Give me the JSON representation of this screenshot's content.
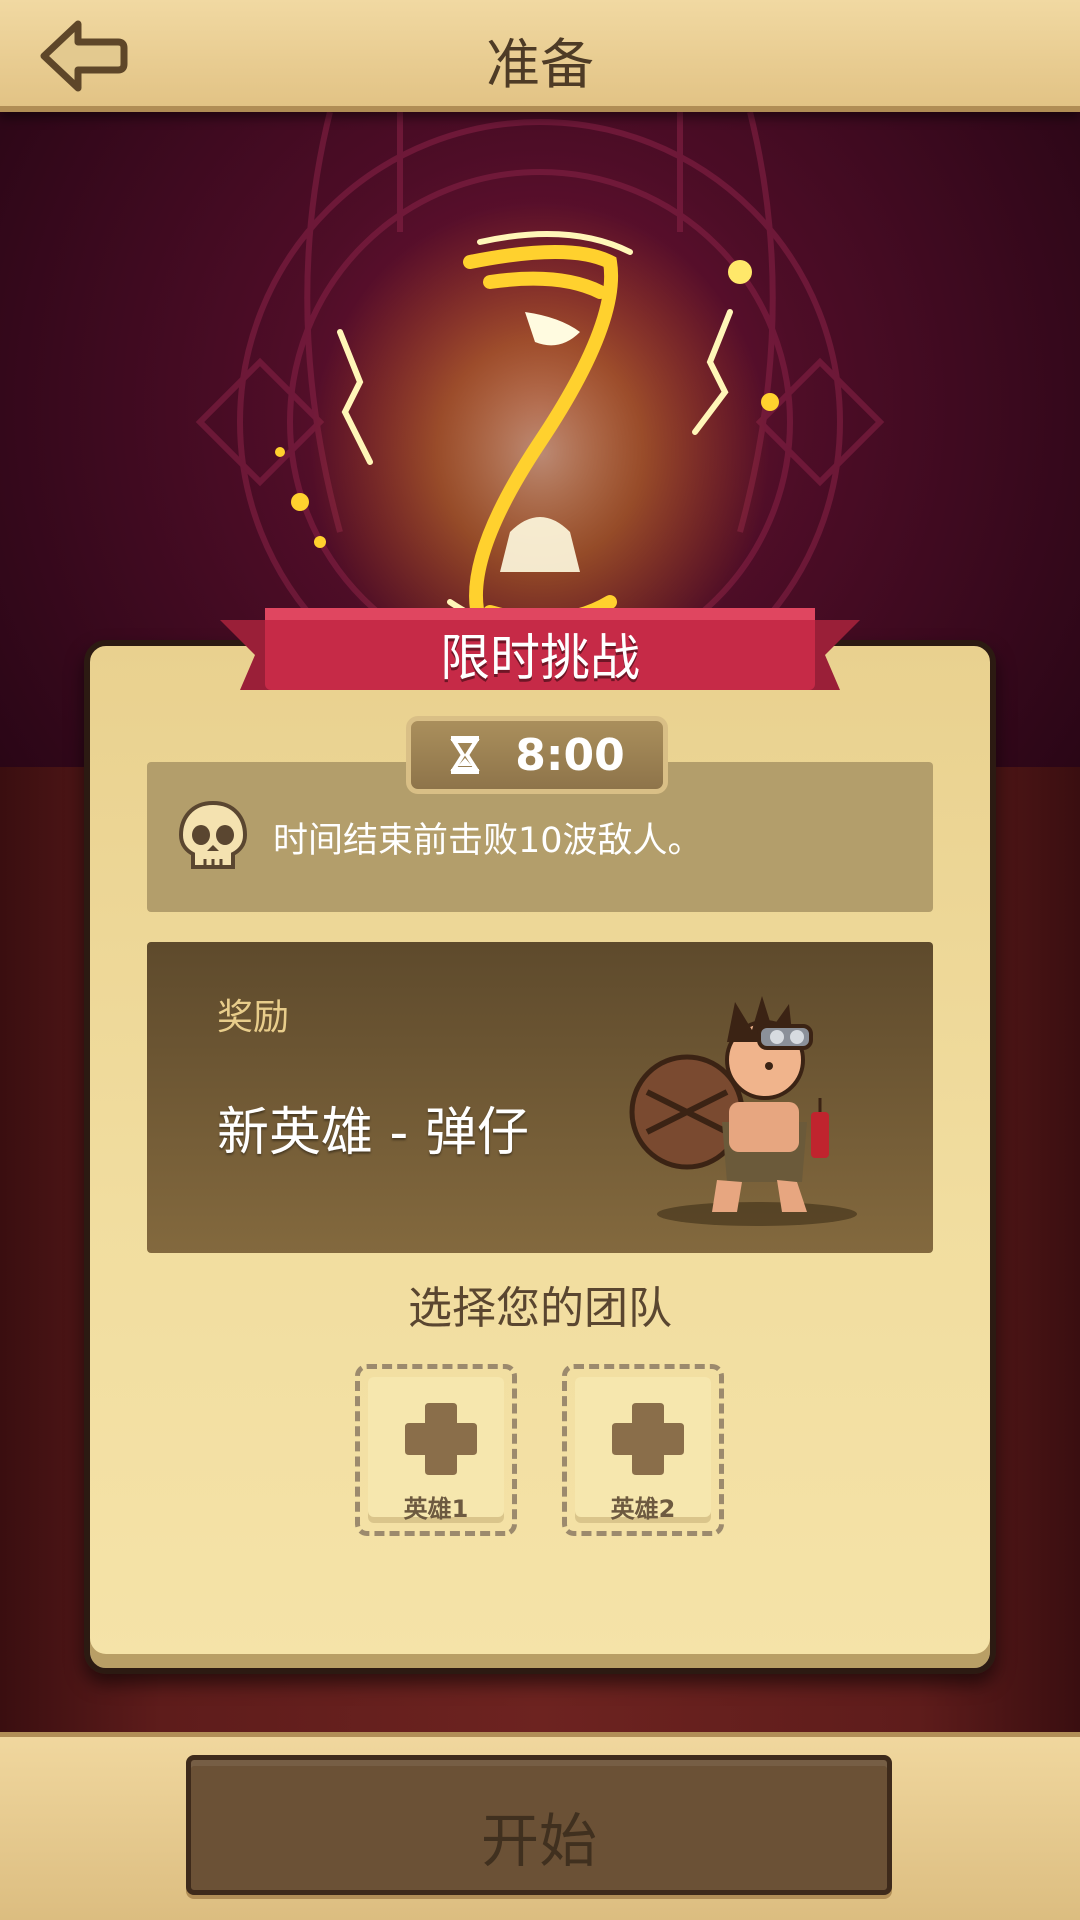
{
  "header": {
    "title": "准备",
    "back_icon": "back-arrow-icon"
  },
  "challenge": {
    "banner_title": "限时挑战",
    "timer_icon": "hourglass-icon",
    "timer": "8:00",
    "objective_icon": "skull-icon",
    "objective_text": "时间结束前击败10波敌人。"
  },
  "reward": {
    "label": "奖励",
    "name": "新英雄 - 弹仔"
  },
  "team": {
    "title": "选择您的团队",
    "slots": [
      {
        "label": "英雄1",
        "icon": "plus-icon"
      },
      {
        "label": "英雄2",
        "icon": "plus-icon"
      }
    ]
  },
  "footer": {
    "start_label": "开始"
  },
  "colors": {
    "parchment": "#f1dd9f",
    "ribbon_red": "#c62a47",
    "panel_brown": "#6b5136",
    "hero_bg": "#4e0d27"
  }
}
